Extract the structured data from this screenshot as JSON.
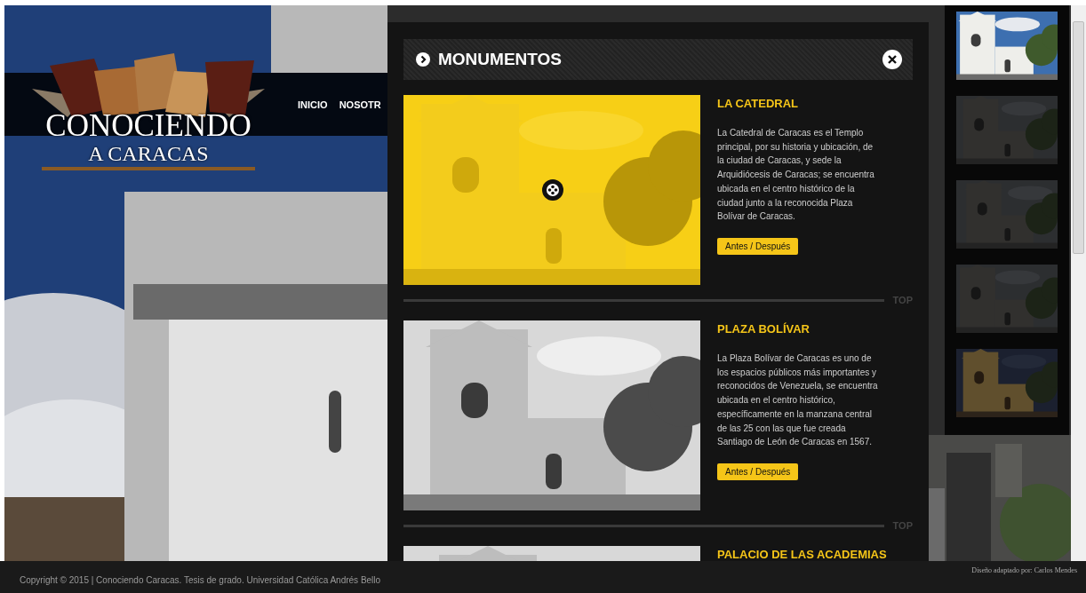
{
  "site": {
    "logo": {
      "line_1": "CONOCIENDO",
      "line_2": "A CARACAS"
    },
    "nav": [
      {
        "label": "INICIO"
      },
      {
        "label": "NOSOTR"
      }
    ]
  },
  "modal": {
    "title": "MONUMENTOS",
    "items": [
      {
        "title": "LA CATEDRAL",
        "description": "La Catedral de Caracas es el Templo principal, por su historia y ubicación, de la ciudad de Caracas, y sede la Arquidiócesis de Caracas; se encuentra ubicada en el centro histórico de la ciudad junto a la reconocida Plaza Bolívar de Caracas.",
        "button": "Antes / Después",
        "highlighted": true,
        "top_link": "TOP"
      },
      {
        "title": "PLAZA BOLÍVAR",
        "description": "La Plaza Bolívar de Caracas es uno de los espacios públicos más importantes y reconocidos de Venezuela, se encuentra ubicada en el centro histórico, específicamente en la manzana central de las 25 con las que fue creada Santiago de León de Caracas en 1567.",
        "button": "Antes / Después",
        "highlighted": false,
        "top_link": "TOP"
      },
      {
        "title": "PALACIO DE LAS ACADEMIAS",
        "highlighted": false
      }
    ]
  },
  "thumbnails": [
    {
      "kind": "picture",
      "selected": true
    },
    {
      "kind": "picture",
      "selected": false
    },
    {
      "kind": "picture",
      "selected": false
    },
    {
      "kind": "picture",
      "selected": false
    },
    {
      "kind": "picture",
      "selected": false
    }
  ],
  "footer": {
    "copyright": "Copyright © 2015 | Conociendo Caracas. Tesis de grado. Universidad Católica Andrés Bello",
    "credit": "Diseño adaptado por: Carlos Mendes"
  }
}
